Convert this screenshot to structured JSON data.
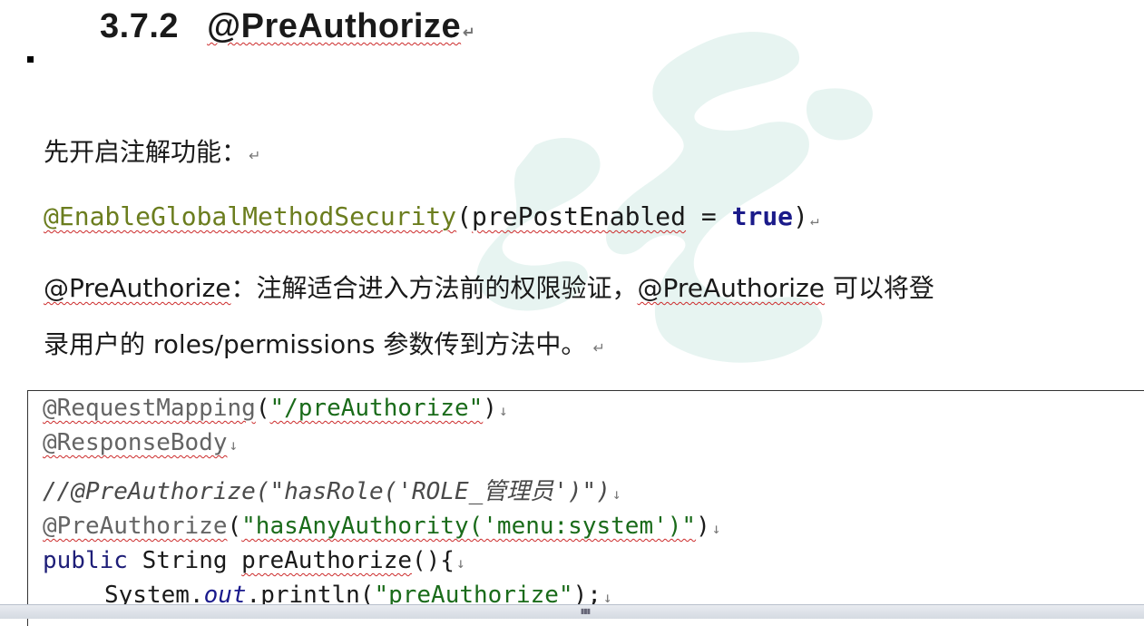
{
  "heading": {
    "number": "3.7.2",
    "title": "@PreAuthorize"
  },
  "paragraphs": {
    "intro": "先开启注解功能：",
    "annotation_name": "@EnableGlobalMethodSecurity",
    "annotation_args_param": "prePostEnabled",
    "annotation_args_eq": " = ",
    "annotation_args_value": "true",
    "desc_line1_name": "@PreAuthorize",
    "desc_line1_text": "：注解适合进入方法前的权限验证，",
    "desc_line1_name2": "@PreAuthorize",
    "desc_line1_tail": " 可以将登",
    "desc_line2": "录用户的 roles/permissions 参数传到方法中。"
  },
  "code": {
    "line1_ann": "@RequestMapping",
    "line1_str": "\"/preAuthorize\"",
    "line2_ann": "@ResponseBody",
    "line3_comment": "//@PreAuthorize(\"hasRole('ROLE_管理员')\")",
    "line4_ann": "@PreAuthorize",
    "line4_str": "\"hasAnyAuthority('menu:system')\"",
    "line5_kw": "public",
    "line5_type": " String ",
    "line5_name": "preAuthorize",
    "line5_tail": "(){",
    "line6_obj": "System.",
    "line6_field": "out",
    "line6_method": ".println(",
    "line6_str": "\"preAuthorize\"",
    "line6_tail": ");"
  },
  "colors": {
    "annotation": "#646464",
    "string": "#1a6b1a",
    "keyword": "#1e1e78",
    "spellcheck": "#cc2a2a",
    "watermark": "#cde8e2"
  }
}
